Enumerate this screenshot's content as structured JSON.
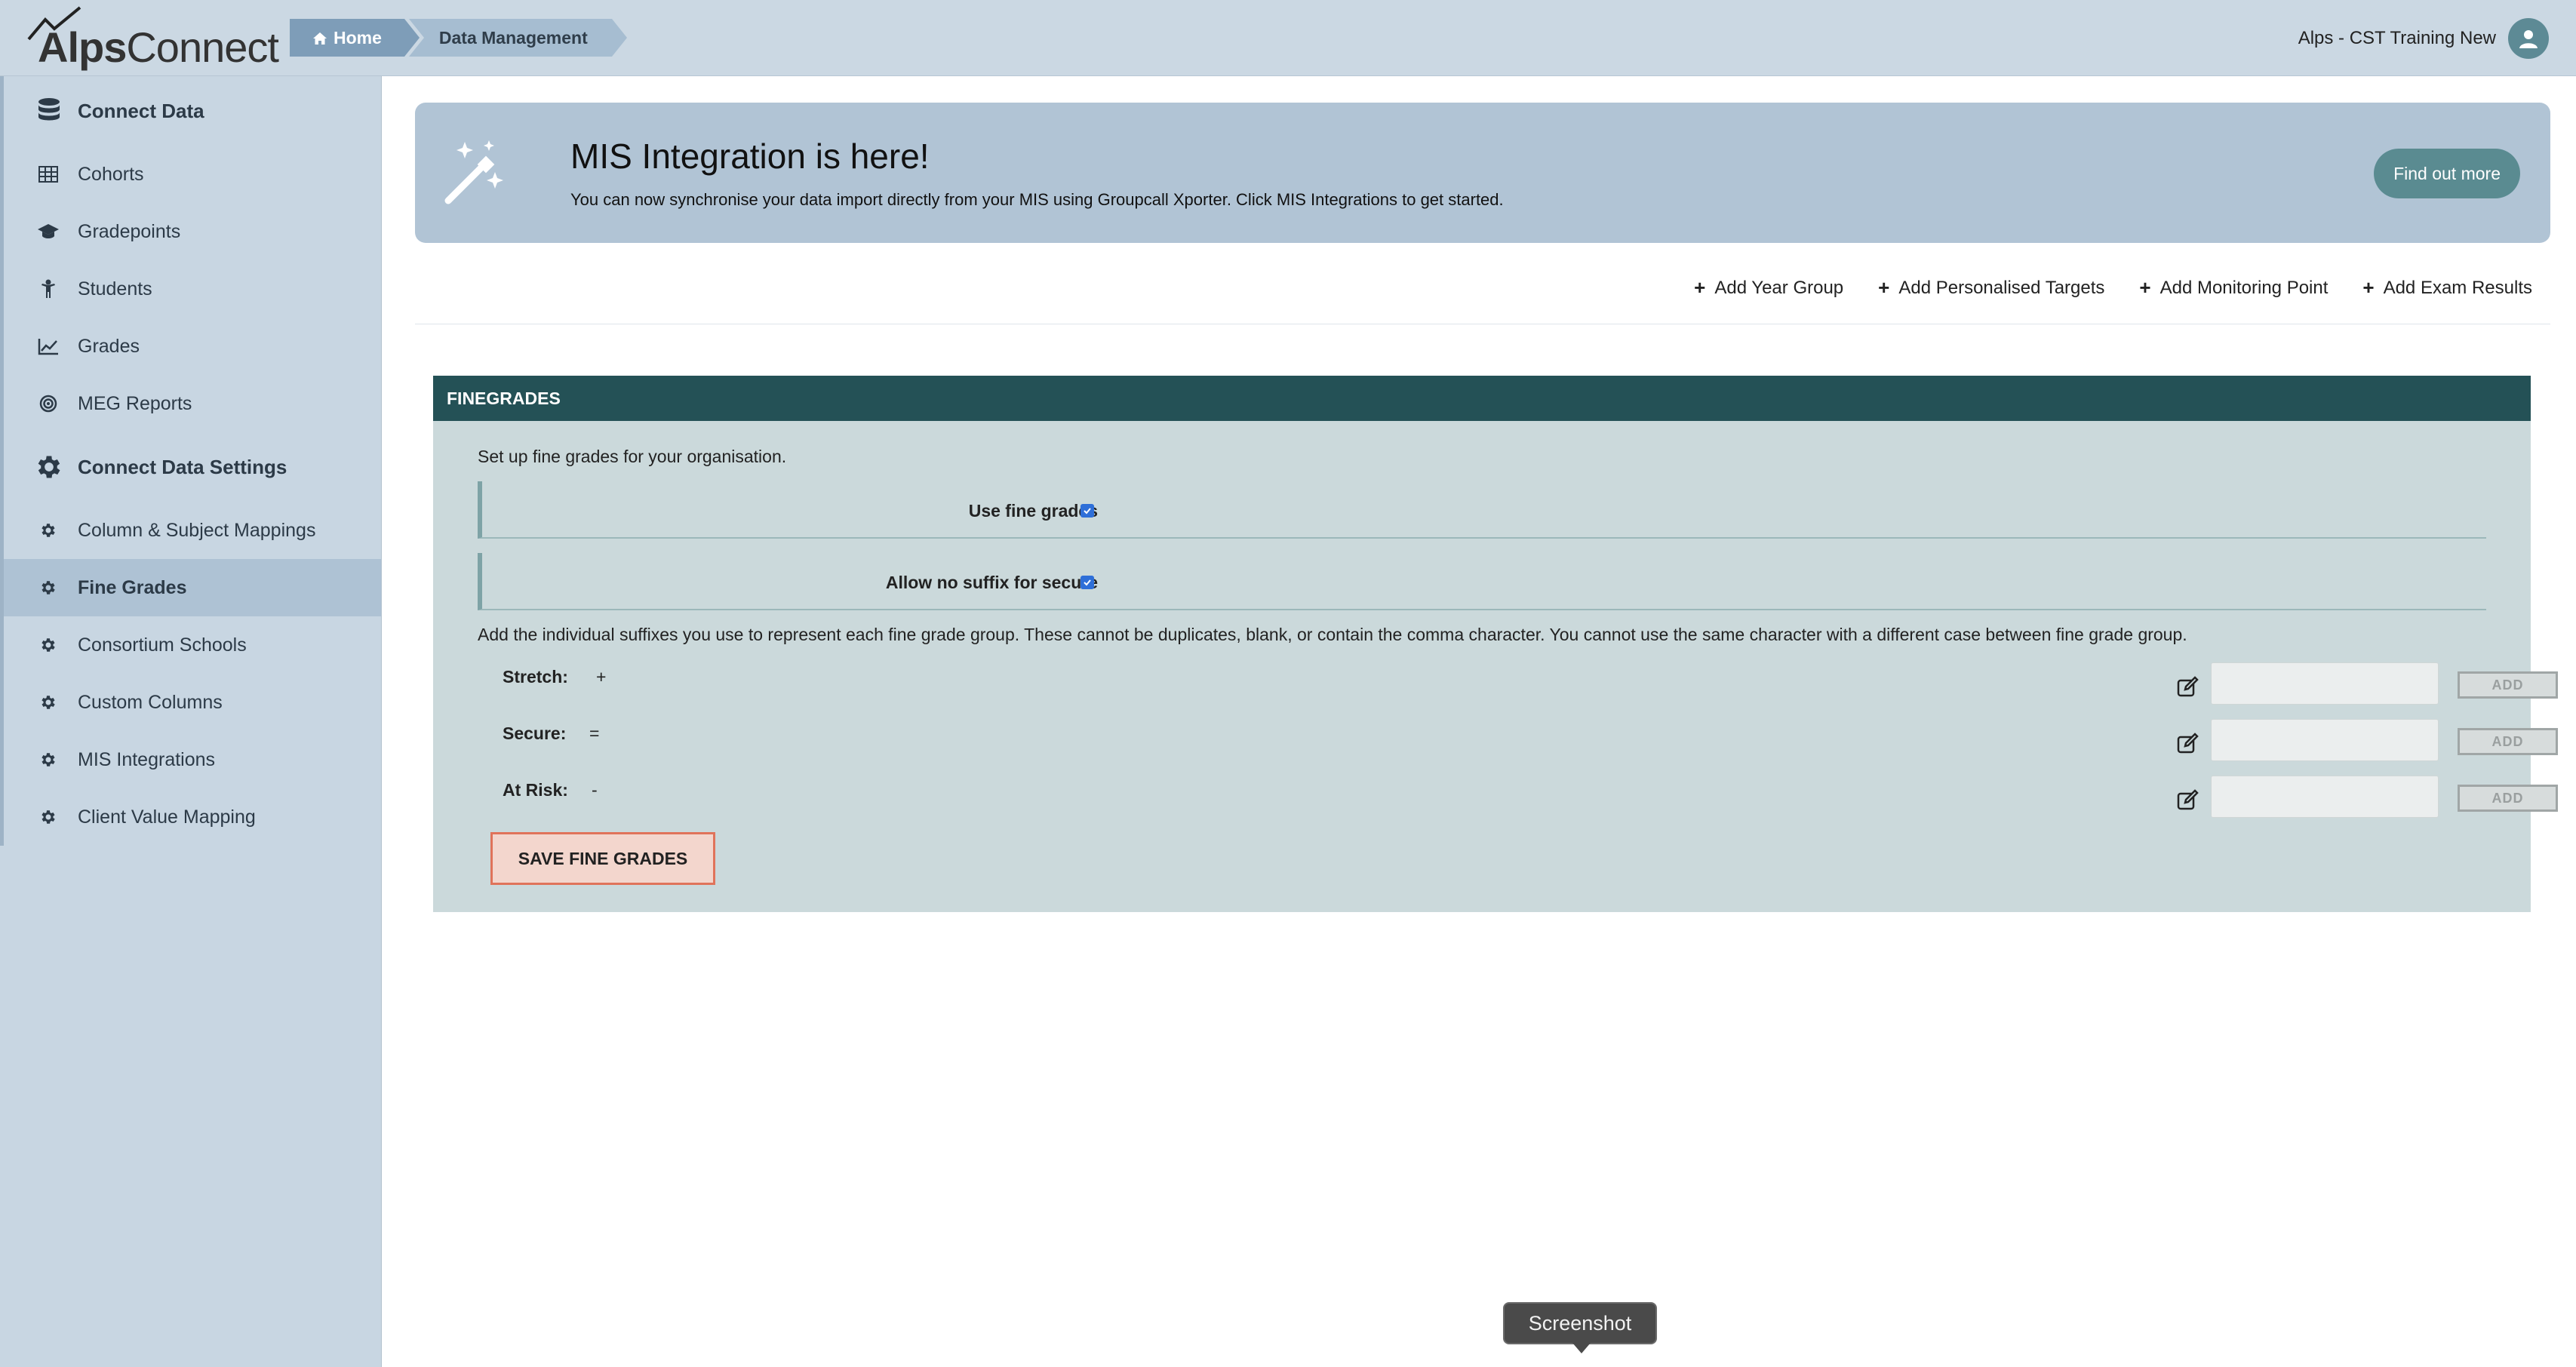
{
  "app": {
    "logo_alps": "Alps",
    "logo_connect": "Connect"
  },
  "breadcrumb": {
    "home": "Home",
    "current": "Data Management"
  },
  "user": {
    "name": "Alps - CST Training New"
  },
  "sidebar": {
    "items": [
      {
        "label": "Connect Data",
        "icon": "database-icon",
        "section": true
      },
      {
        "label": "Cohorts",
        "icon": "table-icon"
      },
      {
        "label": "Gradepoints",
        "icon": "graduation-cap-icon"
      },
      {
        "label": "Students",
        "icon": "child-icon"
      },
      {
        "label": "Grades",
        "icon": "line-chart-icon"
      },
      {
        "label": "MEG Reports",
        "icon": "target-icon"
      },
      {
        "label": "Connect Data Settings",
        "icon": "gear-icon",
        "section": true
      },
      {
        "label": "Column & Subject Mappings",
        "icon": "gear-icon"
      },
      {
        "label": "Fine Grades",
        "icon": "gear-icon",
        "active": true
      },
      {
        "label": "Consortium Schools",
        "icon": "gear-icon"
      },
      {
        "label": "Custom Columns",
        "icon": "gear-icon"
      },
      {
        "label": "MIS Integrations",
        "icon": "gear-icon"
      },
      {
        "label": "Client Value Mapping",
        "icon": "gear-icon"
      }
    ]
  },
  "banner": {
    "title": "MIS Integration is here!",
    "text": "You can now synchronise your data import directly from your MIS using Groupcall Xporter. Click MIS Integrations to get started.",
    "button": "Find out more",
    "icon": "magic-wand-icon"
  },
  "actions": [
    {
      "label": "Add Year Group"
    },
    {
      "label": "Add Personalised Targets"
    },
    {
      "label": "Add Monitoring Point"
    },
    {
      "label": "Add Exam Results"
    }
  ],
  "panel": {
    "title": "FINEGRADES",
    "intro": "Set up fine grades for your organisation.",
    "settings": [
      {
        "label": "Use fine grades",
        "checked": true
      },
      {
        "label": "Allow no suffix for secure",
        "checked": true
      }
    ],
    "suffix_intro": "Add the individual suffixes you use to represent each fine grade group. These cannot be duplicates, blank, or contain the comma character. You cannot use the same character with a different case between fine grade group.",
    "suffixes": [
      {
        "label": "Stretch:",
        "value": "+",
        "input": "",
        "add": "ADD"
      },
      {
        "label": "Secure:",
        "value": "=",
        "input": "",
        "add": "ADD"
      },
      {
        "label": "At Risk:",
        "value": "-",
        "input": "",
        "add": "ADD"
      }
    ],
    "save_button": "SAVE FINE GRADES"
  },
  "tooltip": {
    "text": "Screenshot"
  },
  "colors": {
    "header_bg": "#cbd8e3",
    "sidebar_bg": "#c8d6e2",
    "panel_header": "#245156",
    "accent_button": "#5a8b91",
    "save_border": "#e0735a"
  }
}
